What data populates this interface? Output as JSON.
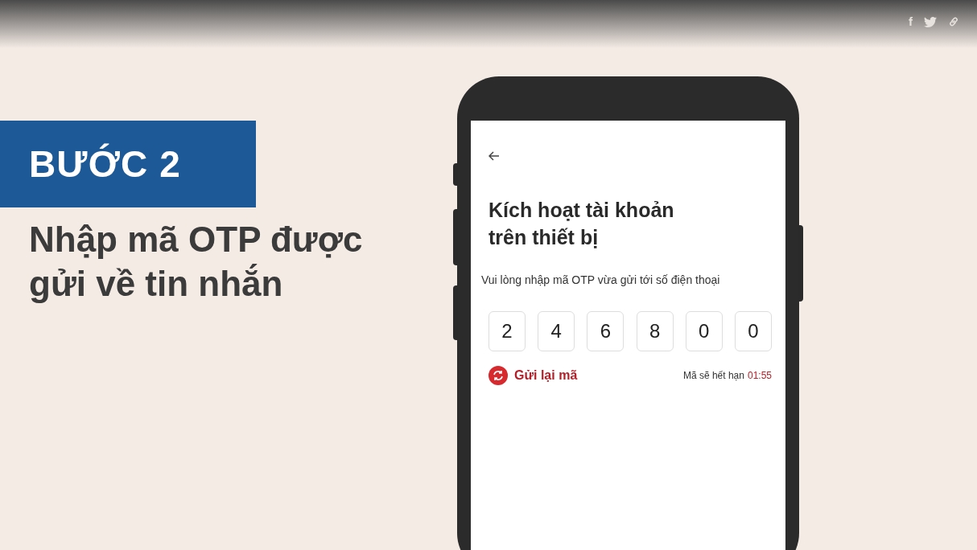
{
  "share_bar": {
    "facebook": "f"
  },
  "step": {
    "badge": "BƯỚC 2",
    "description": "Nhập mã OTP được gửi về tin nhắn"
  },
  "phone_screen": {
    "title": "Kích hoạt tài khoản trên thiết bị",
    "instruction": "Vui lòng nhập mã OTP vừa gửi tới số điện thoại",
    "otp_digits": [
      "2",
      "4",
      "6",
      "8",
      "0",
      "0"
    ],
    "resend": "Gửi lại mã",
    "expiry_label": "Mã sẽ hết hạn",
    "countdown": "01:55"
  }
}
